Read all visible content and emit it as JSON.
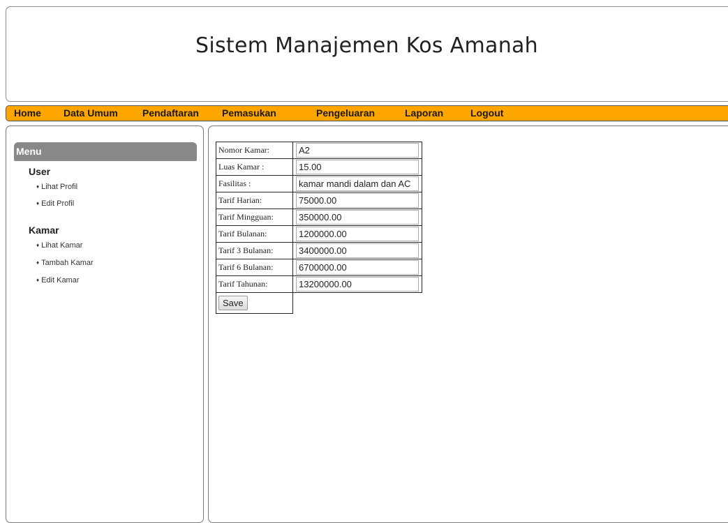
{
  "header": {
    "title": "Sistem Manajemen Kos Amanah"
  },
  "nav": {
    "items": [
      "Home",
      "Data Umum",
      "Pendaftaran",
      "Pemasukan",
      "Pengeluaran",
      "Laporan",
      "Logout"
    ]
  },
  "sidebar": {
    "menu_title": "Menu",
    "groups": [
      {
        "title": "User",
        "links": [
          "Lihat Profil",
          "Edit Profil"
        ]
      },
      {
        "title": "Kamar",
        "links": [
          "Lihat Kamar",
          "Tambah Kamar",
          "Edit Kamar"
        ]
      }
    ],
    "bullet": "♦"
  },
  "form": {
    "rows": [
      {
        "label": "Nomor Kamar:",
        "value": "A2"
      },
      {
        "label": "Luas Kamar :",
        "value": "15.00"
      },
      {
        "label": "Fasilitas :",
        "value": "kamar mandi dalam dan AC"
      },
      {
        "label": "Tarif Harian:",
        "value": "75000.00"
      },
      {
        "label": "Tarif Mingguan:",
        "value": "350000.00"
      },
      {
        "label": "Tarif Bulanan:",
        "value": "1200000.00"
      },
      {
        "label": "Tarif 3 Bulanan:",
        "value": "3400000.00"
      },
      {
        "label": "Tarif 6 Bulanan:",
        "value": "6700000.00"
      },
      {
        "label": "Tarif Tahunan:",
        "value": "13200000.00"
      }
    ],
    "save_label": "Save"
  },
  "colors": {
    "nav_bg": "#ffa500",
    "menu_head_bg": "#888888"
  }
}
